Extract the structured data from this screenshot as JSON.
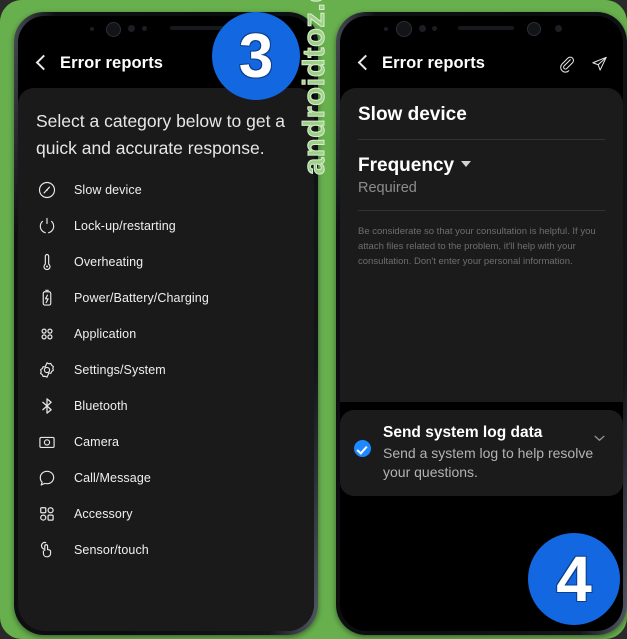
{
  "background_color": "#68b04e",
  "accent_color": "#1367e0",
  "watermark": "androidtoz.com",
  "badges": {
    "step3": "3",
    "step4": "4"
  },
  "left_phone": {
    "header": {
      "title": "Error reports",
      "back_icon": "back-arrow-icon"
    },
    "intro": "Select a category below to get a quick and accurate response.",
    "categories": [
      {
        "label": "Slow device",
        "icon": "speedometer-icon"
      },
      {
        "label": "Lock-up/restarting",
        "icon": "power-restart-icon"
      },
      {
        "label": "Overheating",
        "icon": "thermometer-icon"
      },
      {
        "label": "Power/Battery/Charging",
        "icon": "battery-charging-icon"
      },
      {
        "label": "Application",
        "icon": "apps-grid-icon"
      },
      {
        "label": "Settings/System",
        "icon": "gear-icon"
      },
      {
        "label": "Bluetooth",
        "icon": "bluetooth-icon"
      },
      {
        "label": "Camera",
        "icon": "camera-icon"
      },
      {
        "label": "Call/Message",
        "icon": "message-bubble-icon"
      },
      {
        "label": "Accessory",
        "icon": "accessory-shapes-icon"
      },
      {
        "label": "Sensor/touch",
        "icon": "touch-hand-icon"
      }
    ]
  },
  "right_phone": {
    "header": {
      "title": "Error reports",
      "back_icon": "back-arrow-icon",
      "attach_icon": "paperclip-icon",
      "send_icon": "send-paper-plane-icon"
    },
    "form": {
      "category_title": "Slow device",
      "frequency_label": "Frequency",
      "frequency_value": "Required",
      "dropdown_icon": "caret-down-icon",
      "note": "Be considerate so that your consultation is helpful. If you attach files related to the problem, it'll help with your consultation. Don't enter your personal information."
    },
    "log_card": {
      "title": "Send system log data",
      "subtitle": "Send a system log to help resolve your questions.",
      "checked": true,
      "check_icon": "check-circle-icon",
      "expand_icon": "chevron-down-icon"
    }
  }
}
